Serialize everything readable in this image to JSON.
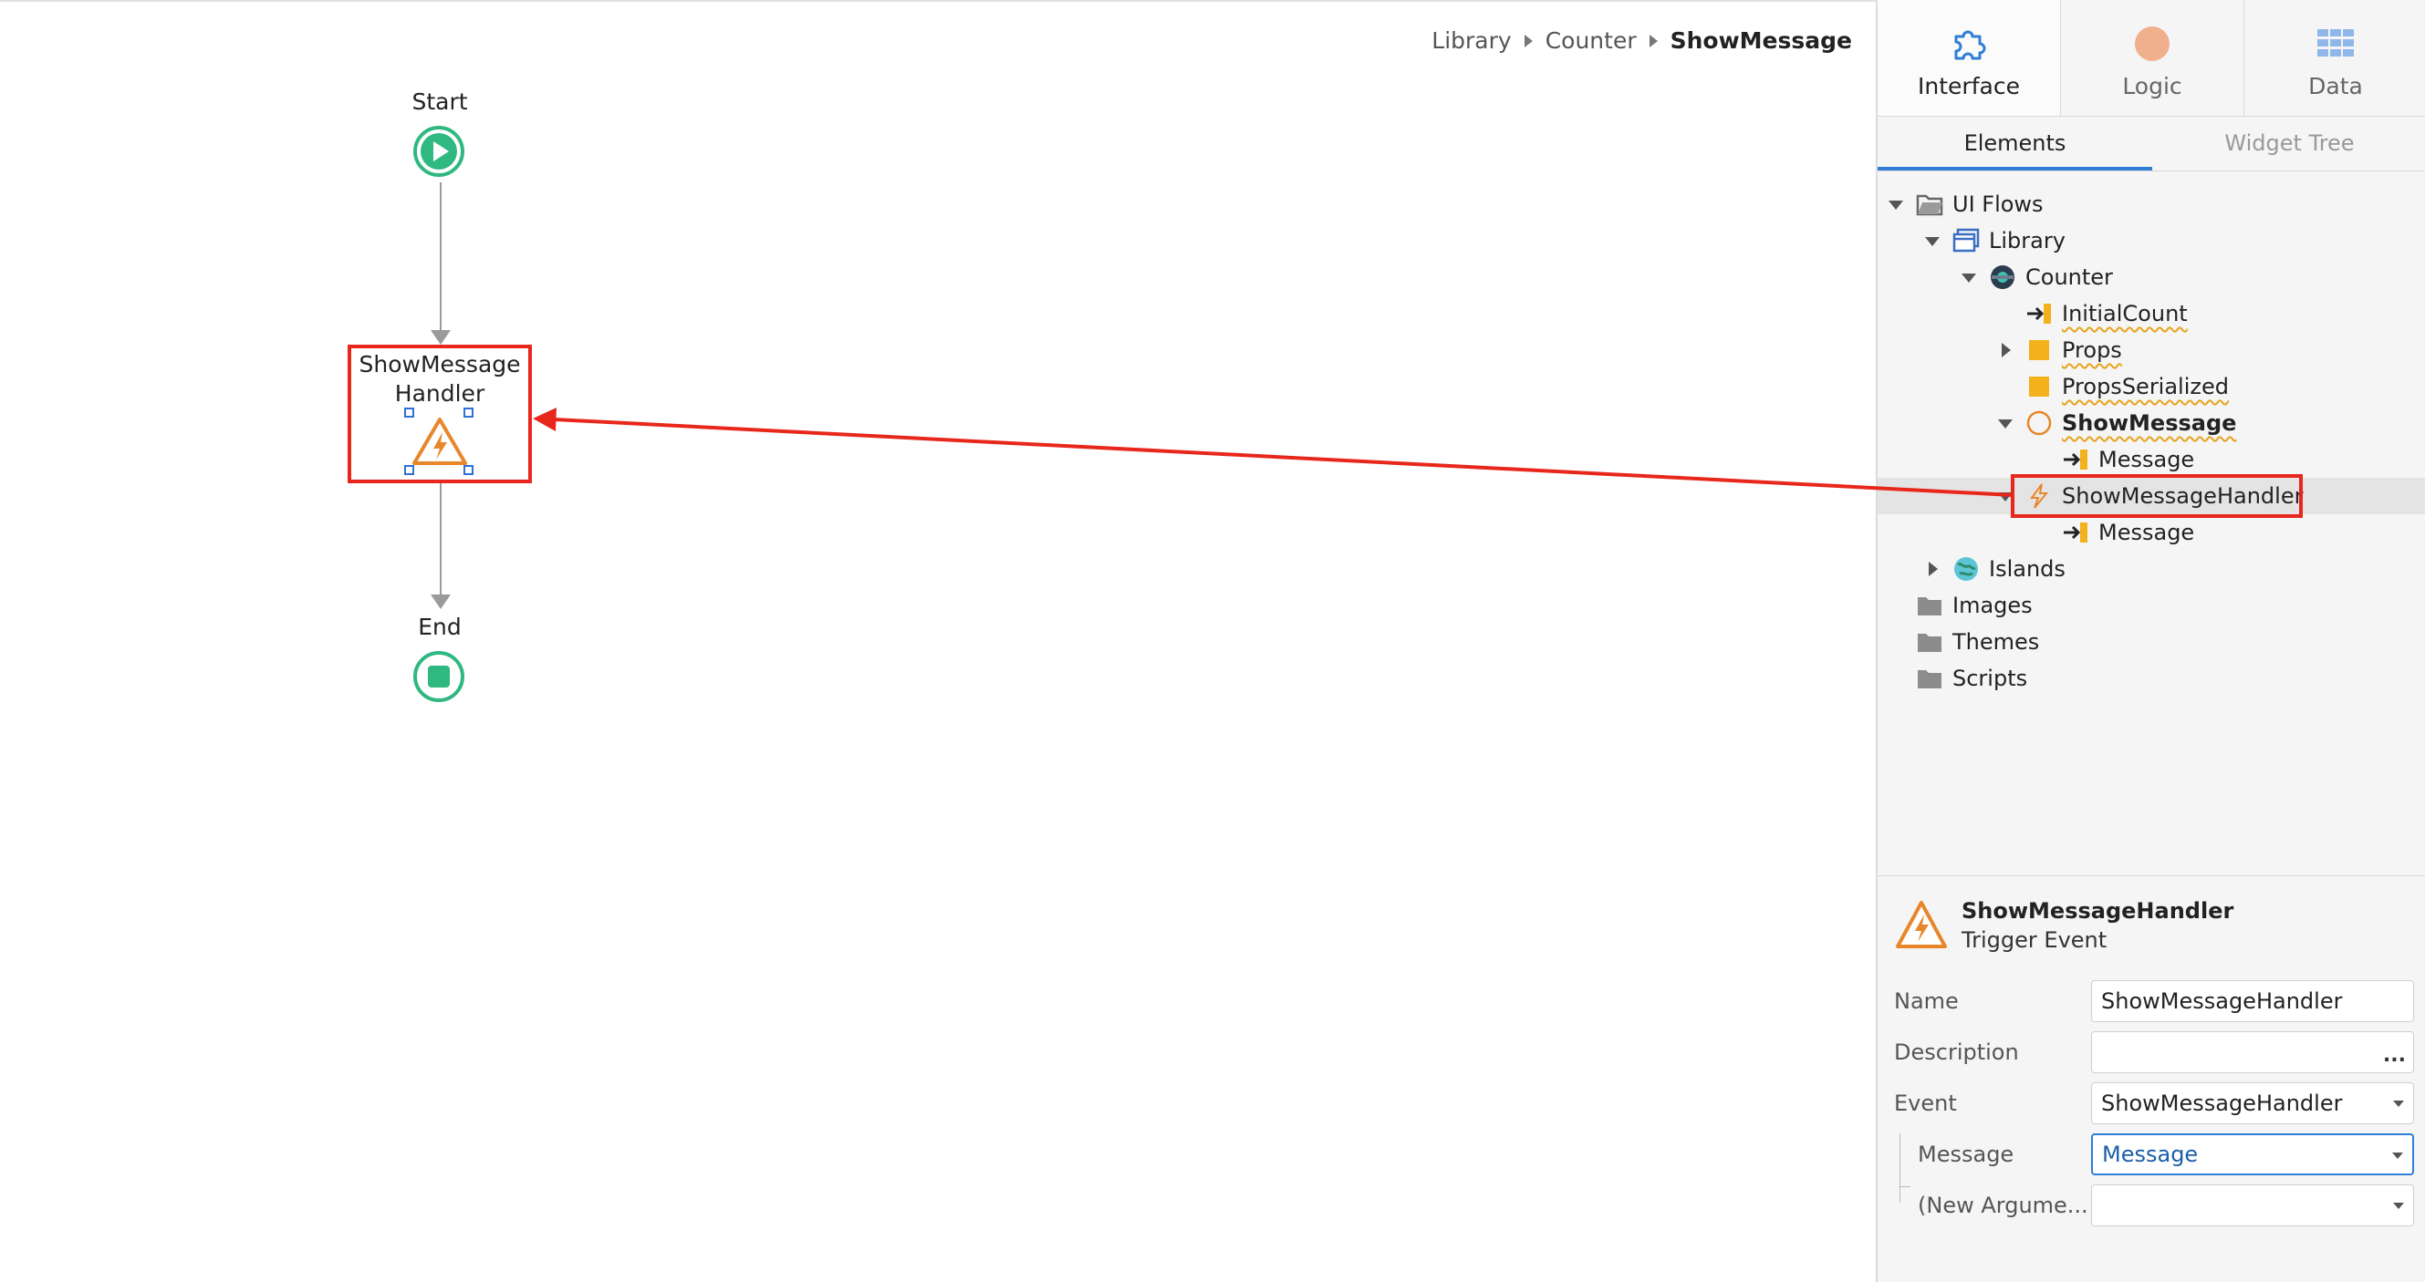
{
  "breadcrumb": {
    "items": [
      "Library",
      "Counter",
      "ShowMessage"
    ]
  },
  "flow": {
    "start_label": "Start",
    "handler_label_line1": "ShowMessage",
    "handler_label_line2": "Handler",
    "end_label": "End"
  },
  "top_tabs": [
    {
      "label": "Interface",
      "icon": "puzzle-icon"
    },
    {
      "label": "Logic",
      "icon": "logic-circle-icon"
    },
    {
      "label": "Data",
      "icon": "data-grid-icon"
    }
  ],
  "sub_tabs": [
    "Elements",
    "Widget Tree"
  ],
  "tree": {
    "ui_flows": "UI Flows",
    "library": "Library",
    "counter": "Counter",
    "initial_count": "InitialCount",
    "props": "Props",
    "props_serialized": "PropsSerialized",
    "show_message": "ShowMessage",
    "show_message_param": "Message",
    "show_message_handler": "ShowMessageHandler",
    "handler_param": "Message",
    "islands": "Islands",
    "images": "Images",
    "themes": "Themes",
    "scripts": "Scripts"
  },
  "properties": {
    "title": "ShowMessageHandler",
    "subtitle": "Trigger Event",
    "name_label": "Name",
    "name_value": "ShowMessageHandler",
    "description_label": "Description",
    "description_value": "",
    "description_more": "...",
    "event_label": "Event",
    "event_value": "ShowMessageHandler",
    "message_label": "Message",
    "message_value": "Message",
    "new_argument_label": "(New Argume...",
    "new_argument_value": ""
  },
  "colors": {
    "accent_green": "#2fb880",
    "warning_orange": "#e8862a",
    "highlight_red": "#e8271c",
    "selection_blue": "#2f7fd6"
  }
}
